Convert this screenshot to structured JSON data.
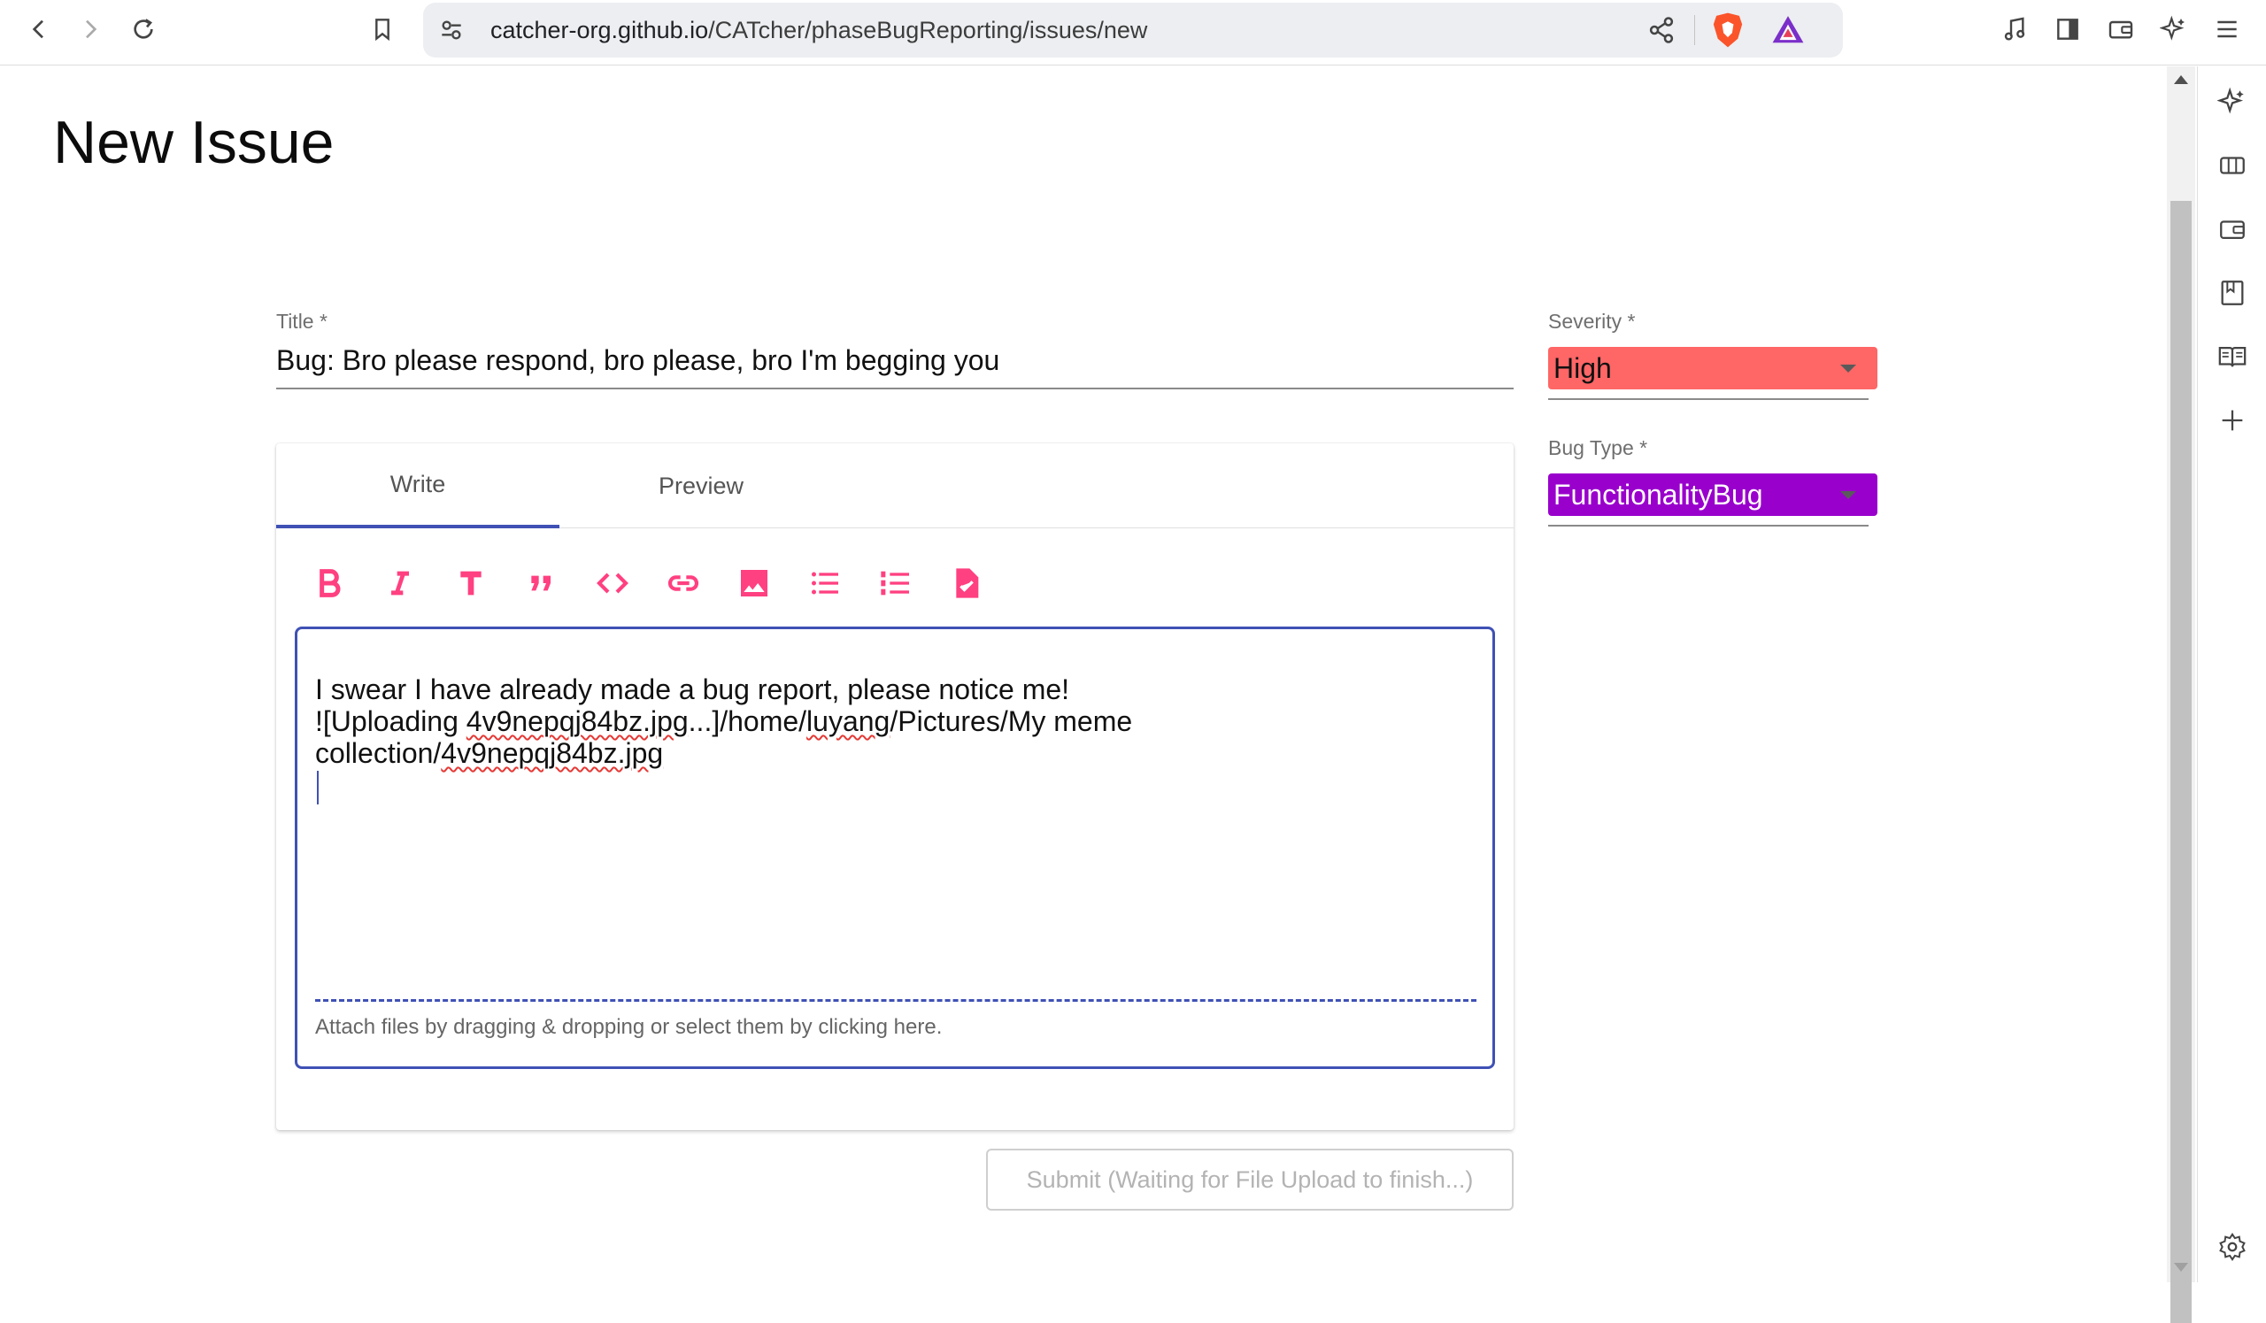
{
  "browser": {
    "url_host": "catcher-org.github.io",
    "url_path": "/CATcher/phaseBugReporting/issues/new"
  },
  "page": {
    "title": "New Issue"
  },
  "form": {
    "title_label": "Title *",
    "title_value": "Bug: Bro please respond, bro please, bro I'm begging you",
    "severity_label": "Severity *",
    "severity_value": "High",
    "severity_color": "#ff6666",
    "bugtype_label": "Bug Type *",
    "bugtype_value": "FunctionalityBug",
    "bugtype_color": "#9900cc"
  },
  "editor": {
    "tabs": [
      "Write",
      "Preview"
    ],
    "active_tab": "Write",
    "toolbar_icons": [
      "bold-icon",
      "italic-icon",
      "heading-icon",
      "quote-icon",
      "code-icon",
      "link-icon",
      "image-icon",
      "bulleted-list-icon",
      "numbered-list-icon",
      "task-list-icon"
    ],
    "line1": "I swear I have already made a bug report, please notice me!",
    "line2_a": "![Uploading ",
    "line2_b": "4v9nepqj84bz.jpg",
    "line2_c": "...]/home/",
    "line2_d": "luyang",
    "line2_e": "/Pictures/My meme",
    "line3_a": "collection/",
    "line3_b": "4v9nepqj84bz.jpg",
    "attach_hint": "Attach files by dragging & dropping or select them by clicking here.",
    "accent_color": "#3f51b5",
    "icon_color": "#ff4081"
  },
  "actions": {
    "submit_label": "Submit (Waiting for File Upload to finish...)"
  }
}
